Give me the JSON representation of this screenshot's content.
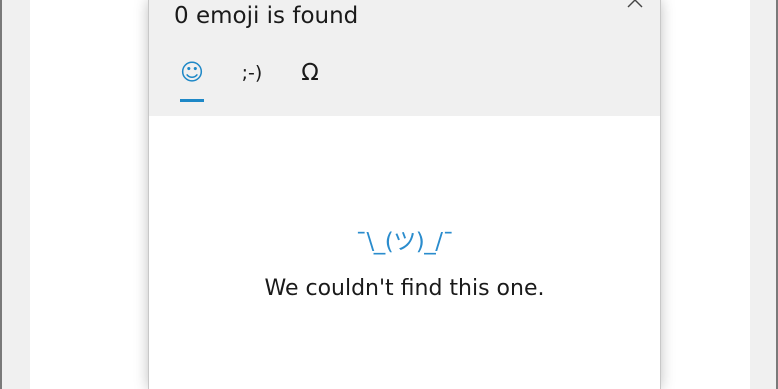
{
  "panel": {
    "result_title": "0 emoji is found",
    "close_icon": "close-icon"
  },
  "tabs": [
    {
      "label": "☺",
      "icon": "smiley-icon",
      "selected": true
    },
    {
      "label": ";-)",
      "icon": "kaomoji-icon",
      "selected": false
    },
    {
      "label": "Ω",
      "icon": "omega-icon",
      "selected": false
    }
  ],
  "empty_state": {
    "kaomoji": "¯\\_(ツ)_/¯",
    "message": "We couldn't find this one."
  },
  "colors": {
    "accent": "#1e88c7",
    "header_bg": "#f0f0f0",
    "panel_bg": "#ffffff"
  }
}
